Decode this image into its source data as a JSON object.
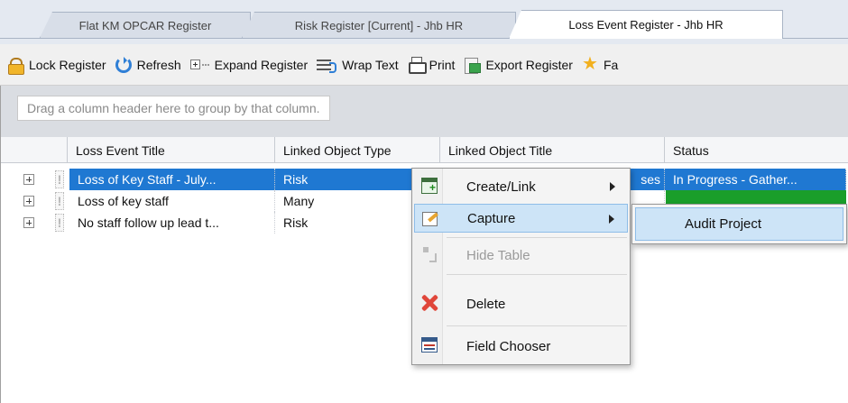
{
  "tabs": [
    {
      "label": "Flat KM OPCAR Register",
      "active": false
    },
    {
      "label": "Risk Register [Current] - Jhb HR",
      "active": false
    },
    {
      "label": "Loss Event Register - Jhb HR",
      "active": true
    }
  ],
  "toolbar": {
    "lock_label": "Lock Register",
    "refresh_label": "Refresh",
    "expand_label": "Expand Register",
    "wrap_label": "Wrap Text",
    "print_label": "Print",
    "export_label": "Export Register",
    "favourite_label": "Fa"
  },
  "grid": {
    "group_hint": "Drag a column header here to group by that column.",
    "columns": [
      "Loss Event Title",
      "Linked Object Type",
      "Linked Object Title",
      "Status"
    ],
    "rows": [
      {
        "title": "Loss of Key Staff - July...",
        "type": "Risk",
        "object_title": "ses",
        "status": "In Progress - Gather...",
        "selected": true,
        "status_color": "#1f78d2"
      },
      {
        "title": "Loss of key staff",
        "type": "Many",
        "object_title": "",
        "status": "",
        "selected": false,
        "status_color": "#1a9e2a"
      },
      {
        "title": "No staff follow up lead t...",
        "type": "Risk",
        "object_title": "",
        "status": "",
        "selected": false,
        "status_color": "#e07820"
      }
    ]
  },
  "context_menu": {
    "items": [
      {
        "label": "Create/Link",
        "icon": "create-link-icon",
        "submenu": true,
        "highlighted": false,
        "disabled": false
      },
      {
        "label": "Capture",
        "icon": "capture-icon",
        "submenu": true,
        "highlighted": true,
        "disabled": false
      },
      {
        "label": "Hide Table",
        "icon": "hide-table-icon",
        "submenu": false,
        "highlighted": false,
        "disabled": true
      },
      {
        "label": "Delete",
        "icon": "delete-icon",
        "submenu": false,
        "highlighted": false,
        "disabled": false
      },
      {
        "label": "Field Chooser",
        "icon": "field-chooser-icon",
        "submenu": false,
        "highlighted": false,
        "disabled": false
      }
    ]
  },
  "submenu": {
    "items": [
      {
        "label": "Audit Project",
        "highlighted": true
      }
    ]
  },
  "colors": {
    "selection": "#1f78d2",
    "menu_highlight": "#cde4f7",
    "status_green": "#1a9e2a",
    "status_orange": "#e07820"
  }
}
